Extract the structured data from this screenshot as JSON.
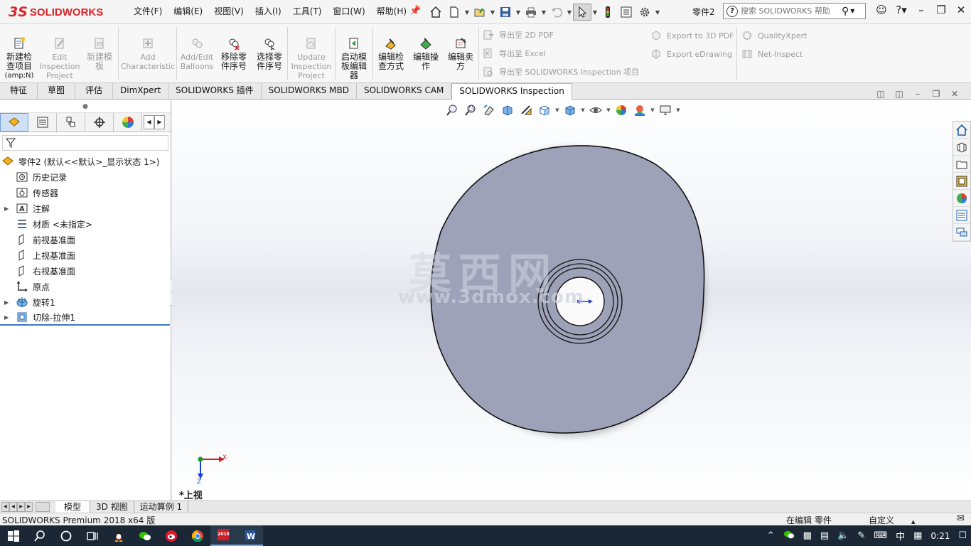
{
  "app": {
    "logo_ds": "3S",
    "logo_text": "SOLIDWORKS",
    "document": "零件2",
    "search_placeholder": "搜索 SOLIDWORKS 帮助"
  },
  "menu": [
    "文件(F)",
    "编辑(E)",
    "视图(V)",
    "插入(I)",
    "工具(T)",
    "窗口(W)",
    "帮助(H)"
  ],
  "ribbon": {
    "new_project": [
      "新建检",
      "查项目",
      "(amp;N)"
    ],
    "edit_project": [
      "Edit",
      "Inspection",
      "Project"
    ],
    "new_template": [
      "新建模",
      "板"
    ],
    "add_characteristic": [
      "Add",
      "Characteristic"
    ],
    "add_balloons": [
      "Add/Edit",
      "Balloons"
    ],
    "remove_part_no": [
      "移除零",
      "件序号"
    ],
    "select_part_no": [
      "选择零",
      "件序号"
    ],
    "update_project": [
      "Update",
      "Inspection",
      "Project"
    ],
    "launch_editor": [
      "启动模",
      "板编辑",
      "器"
    ],
    "edit_method": [
      "编辑检",
      "查方式"
    ],
    "edit_operation": [
      "编辑操",
      "作"
    ],
    "edit_vendor": [
      "编辑卖",
      "方"
    ],
    "export_2d_pdf": "导出至 2D PDF",
    "export_excel": "导出至 Excel",
    "export_sw_project": "导出至 SOLIDWORKS Inspection 项目",
    "export_3d_pdf": "Export to 3D PDF",
    "export_edrawing": "Export eDrawing",
    "qualityxpert": "QualityXpert",
    "net_inspect": "Net-Inspect"
  },
  "command_tabs": [
    "特征",
    "草图",
    "评估",
    "DimXpert",
    "SOLIDWORKS 插件",
    "SOLIDWORKS MBD",
    "SOLIDWORKS CAM",
    "SOLIDWORKS Inspection"
  ],
  "active_command_tab": "SOLIDWORKS Inspection",
  "feature_tree": {
    "root": "零件2  (默认<<默认>_显示状态 1>)",
    "items": [
      {
        "label": "历史记录",
        "icon": "history-folder-icon",
        "expandable": false
      },
      {
        "label": "传感器",
        "icon": "sensor-folder-icon",
        "expandable": false
      },
      {
        "label": "注解",
        "icon": "annotation-folder-icon",
        "expandable": true
      },
      {
        "label": "材质 <未指定>",
        "icon": "material-icon",
        "expandable": false
      },
      {
        "label": "前视基准面",
        "icon": "plane-icon",
        "expandable": false
      },
      {
        "label": "上视基准面",
        "icon": "plane-icon",
        "expandable": false
      },
      {
        "label": "右视基准面",
        "icon": "plane-icon",
        "expandable": false
      },
      {
        "label": "原点",
        "icon": "origin-icon",
        "expandable": false
      },
      {
        "label": "旋转1",
        "icon": "revolve-feature-icon",
        "expandable": true
      },
      {
        "label": "切除-拉伸1",
        "icon": "cut-extrude-feature-icon",
        "expandable": true
      }
    ]
  },
  "viewport": {
    "watermark_cn": "莫西网",
    "watermark_url": "www.3dmox.com",
    "view_label": "*上视",
    "triad_x": "X",
    "triad_z": "Z",
    "model_color": "#9ea2b8"
  },
  "model_tabs": [
    "模型",
    "3D 视图",
    "运动算例 1"
  ],
  "active_model_tab": "模型",
  "status": {
    "product": "SOLIDWORKS Premium 2018 x64 版",
    "editing": "在编辑 零件",
    "units": "自定义"
  },
  "taskbar": {
    "year_badge": "2018",
    "ime": "中",
    "clock": "0:21"
  },
  "colors": {
    "accent_red": "#d9252a",
    "selection_blue": "#3b78c4",
    "taskbar_bg": "#1b2735"
  }
}
